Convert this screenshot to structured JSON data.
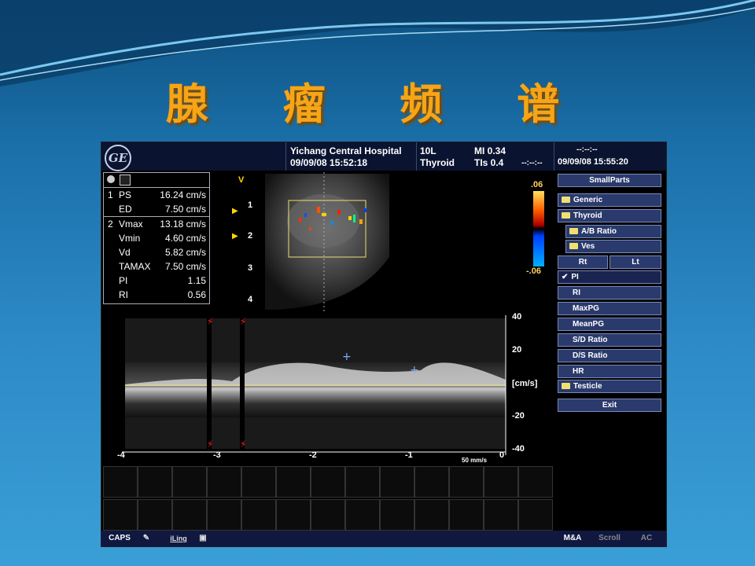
{
  "slide": {
    "title": "腺 瘤 频 谱"
  },
  "header": {
    "logo": "GE",
    "hospital": "Yichang Central Hospital",
    "datetime": "09/09/08 15:52:18",
    "probe": "10L",
    "preset": "Thyroid",
    "mi": "MI 0.34",
    "tis": "TIs 0.4",
    "dashes_mid": "--:--:--",
    "dashes_top": "--:--:--",
    "datetime_right": "09/09/08 15:55:20"
  },
  "measurements": {
    "rows": [
      {
        "idx": "1",
        "name": "PS",
        "value": "16.24 cm/s"
      },
      {
        "idx": "",
        "name": "ED",
        "value": "7.50 cm/s"
      },
      {
        "idx": "2",
        "name": "Vmax",
        "value": "13.18 cm/s"
      },
      {
        "idx": "",
        "name": "Vmin",
        "value": "4.60 cm/s"
      },
      {
        "idx": "",
        "name": "Vd",
        "value": "5.82 cm/s"
      },
      {
        "idx": "",
        "name": "TAMAX",
        "value": "7.50 cm/s"
      },
      {
        "idx": "",
        "name": "PI",
        "value": "1.15"
      },
      {
        "idx": "",
        "name": "RI",
        "value": "0.56"
      }
    ]
  },
  "bmode": {
    "marker": "V",
    "depths": [
      "1",
      "2",
      "3",
      "4"
    ],
    "colorbar_top": ".06",
    "colorbar_bottom": "-.06"
  },
  "doppler": {
    "scale": [
      "40",
      "20",
      "[cm/s]",
      "-20",
      "-40"
    ],
    "time_ticks": [
      "-4",
      "-3",
      "-2",
      "-1",
      "0"
    ],
    "sweep": "50 mm/s"
  },
  "menu": {
    "title": "SmallParts",
    "items": [
      {
        "label": "Generic",
        "icon": "folder-icon"
      },
      {
        "label": "Thyroid",
        "icon": "folder-icon"
      },
      {
        "label": "A/B Ratio",
        "icon": "folder-icon"
      },
      {
        "label": "Ves",
        "icon": "folder-icon"
      }
    ],
    "rt": "Rt",
    "lt": "Lt",
    "pi": "PI",
    "options": [
      "RI",
      "MaxPG",
      "MeanPG",
      "S/D Ratio",
      "D/S Ratio",
      "HR"
    ],
    "testicle": "Testicle",
    "exit": "Exit"
  },
  "bottom_bar": {
    "caps": "CAPS",
    "iling": "iLing",
    "ma": "M&A",
    "scroll": "Scroll",
    "ac": "AC"
  },
  "colors": {
    "title": "#f6a516",
    "menu_button": "#2a3a6c",
    "doppler_box": "#e8e070"
  }
}
